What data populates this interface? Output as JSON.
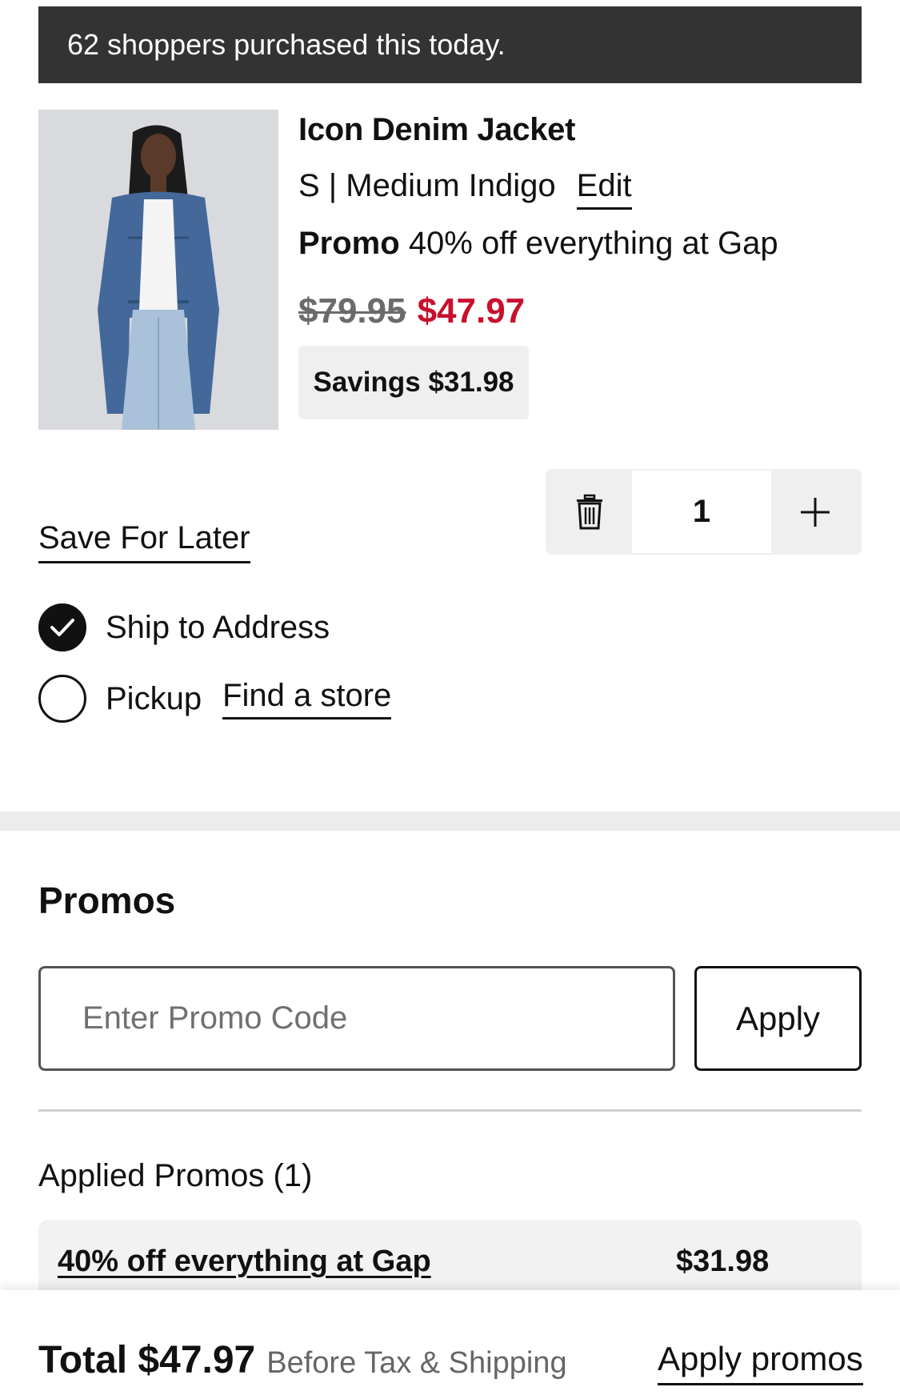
{
  "banner": {
    "text": "62 shoppers purchased this today."
  },
  "product": {
    "name": "Icon Denim Jacket",
    "variant": "S | Medium Indigo",
    "edit_label": "Edit",
    "promo_label": "Promo",
    "promo_text": "40% off everything at Gap",
    "original_price": "$79.95",
    "sale_price": "$47.97",
    "savings": "Savings $31.98",
    "quantity": "1"
  },
  "actions": {
    "save_for_later": "Save For Later"
  },
  "fulfillment": {
    "ship_label": "Ship to Address",
    "ship_selected": true,
    "pickup_label": "Pickup",
    "find_store": "Find a store"
  },
  "promos": {
    "title": "Promos",
    "input_placeholder": "Enter Promo Code",
    "apply_label": "Apply",
    "applied_title": "Applied Promos (1)",
    "applied": [
      {
        "name": "40% off everything at Gap",
        "amount": "$31.98"
      }
    ]
  },
  "footer": {
    "total_label": "Total $47.97",
    "total_note": "Before Tax & Shipping",
    "apply_promos": "Apply promos"
  },
  "colors": {
    "sale_red": "#c8102e",
    "banner_bg": "#333333"
  }
}
